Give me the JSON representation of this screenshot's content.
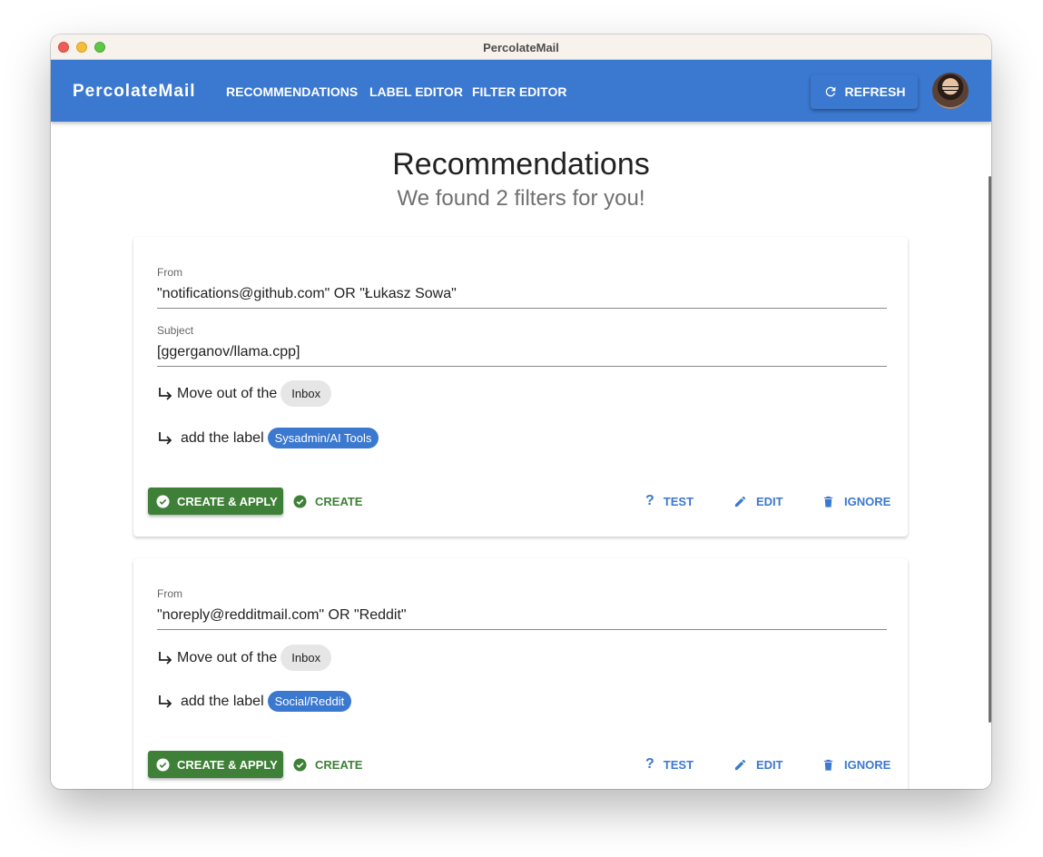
{
  "window": {
    "title": "PercolateMail"
  },
  "appbar": {
    "brand": "PercolateMail",
    "nav": [
      "RECOMMENDATIONS",
      "LABEL EDITOR",
      "FILTER EDITOR"
    ],
    "refresh_label": "REFRESH"
  },
  "page": {
    "title": "Recommendations",
    "subtitle": "We found 2 filters for you!"
  },
  "filters": [
    {
      "from_label": "From",
      "from_value": "\"notifications@github.com\" OR \"Łukasz Sowa\"",
      "subject_label": "Subject",
      "subject_value": "[ggerganov/llama.cpp]",
      "move_text": "Move out of the",
      "move_chip": "Inbox",
      "label_text": "add the label",
      "label_chip": "Sysadmin/AI Tools",
      "buttons": {
        "apply": "CREATE & APPLY",
        "create": "CREATE",
        "test": "TEST",
        "edit": "EDIT",
        "ignore": "IGNORE"
      }
    },
    {
      "from_label": "From",
      "from_value": "\"noreply@redditmail.com\" OR \"Reddit\"",
      "move_text": "Move out of the",
      "move_chip": "Inbox",
      "label_text": "add the label",
      "label_chip": "Social/Reddit",
      "buttons": {
        "apply": "CREATE & APPLY",
        "create": "CREATE",
        "test": "TEST",
        "edit": "EDIT",
        "ignore": "IGNORE"
      }
    }
  ],
  "colors": {
    "primary": "#3b78cf",
    "success": "#3e8037",
    "titlebar": "#f8f2ed"
  }
}
